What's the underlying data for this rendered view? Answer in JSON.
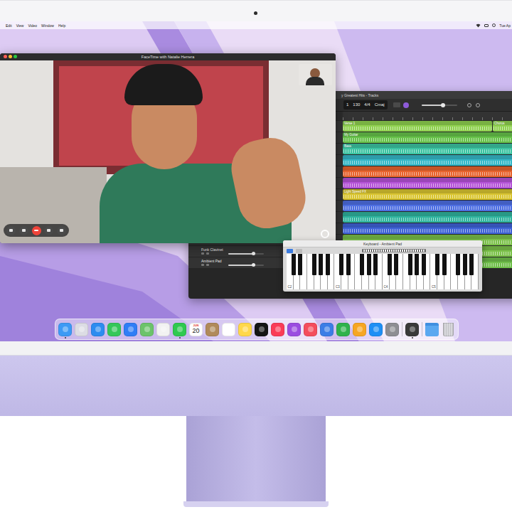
{
  "menubar": {
    "menus": [
      "Edit",
      "View",
      "Video",
      "Window",
      "Help"
    ],
    "clock": "Tue Ap"
  },
  "facetime": {
    "title": "FaceTime with Natalie Herrera",
    "controls": [
      {
        "kind": "sidebar"
      },
      {
        "kind": "mute"
      },
      {
        "kind": "end-call"
      },
      {
        "kind": "camera"
      },
      {
        "kind": "fullscreen"
      }
    ]
  },
  "garageband": {
    "title": "y Greatest Hits - Tracks",
    "lcd": {
      "bar": "1",
      "tempo": "130",
      "signature": "4/4",
      "key": "Cmaj"
    },
    "master_volume": {
      "level": 0.6
    },
    "tracks": [
      {
        "color": "#8fd14f",
        "labels": [
          "Verse 1",
          "Chorus"
        ]
      },
      {
        "color": "#67c24a",
        "labels": [
          "My Guitar"
        ]
      },
      {
        "color": "#3cc4a2",
        "labels": [
          "Bass"
        ]
      },
      {
        "color": "#35b8c8",
        "labels": []
      },
      {
        "color": "#e8642e",
        "labels": []
      },
      {
        "color": "#b553d8",
        "labels": []
      },
      {
        "color": "#d9c531",
        "labels": [
          "Light Speed FX"
        ]
      },
      {
        "color": "#4e6fe3",
        "labels": []
      },
      {
        "color": "#2fb49e",
        "labels": []
      },
      {
        "color": "#3f62d6",
        "labels": []
      },
      {
        "color": "#7cc24b",
        "labels": []
      },
      {
        "name": "Funk Clavinet",
        "level": 0.7,
        "color": "#7cc24b",
        "labels": []
      },
      {
        "name": "Ambient Pad",
        "level": 0.7,
        "color": "#6fbf4a",
        "labels": []
      }
    ]
  },
  "keyboard": {
    "title": "Keyboard - Ambient Pad",
    "labels": [
      "C2",
      "C3",
      "C4",
      "C5"
    ]
  },
  "dock": {
    "items": [
      {
        "kind": "app",
        "color": "#3d9af5",
        "running": true
      },
      {
        "kind": "app",
        "color": "#dcdce4",
        "running": false
      },
      {
        "kind": "app",
        "color": "#2d8cf0",
        "running": false
      },
      {
        "kind": "app",
        "color": "#34c759",
        "running": false
      },
      {
        "kind": "app",
        "color": "#2f7df6",
        "running": false
      },
      {
        "kind": "app",
        "color": "#6cc36b",
        "running": false
      },
      {
        "kind": "app",
        "color": "#f2f2f2",
        "running": false
      },
      {
        "kind": "app",
        "color": "#2fc94f",
        "running": true
      },
      {
        "kind": "calendar",
        "color": "#ffffff",
        "month": "JUN",
        "day": "20",
        "running": false
      },
      {
        "kind": "app",
        "color": "#b08a5a",
        "running": false
      },
      {
        "kind": "app",
        "color": "#ffffff",
        "running": false
      },
      {
        "kind": "app",
        "color": "#ffd84a",
        "running": false
      },
      {
        "kind": "app",
        "color": "#151515",
        "running": false
      },
      {
        "kind": "app",
        "color": "#fa3c57",
        "running": false
      },
      {
        "kind": "app",
        "color": "#9b4de0",
        "running": false
      },
      {
        "kind": "app",
        "color": "#f44d5c",
        "running": false
      },
      {
        "kind": "app",
        "color": "#3b7de6",
        "running": false
      },
      {
        "kind": "app",
        "color": "#2fb24c",
        "running": false
      },
      {
        "kind": "app",
        "color": "#f6a623",
        "running": false
      },
      {
        "kind": "app",
        "color": "#1e8ff5",
        "running": false
      },
      {
        "kind": "app",
        "color": "#8e8e93",
        "running": false
      },
      {
        "kind": "separator"
      },
      {
        "kind": "app",
        "color": "#3a3a3a",
        "running": true
      },
      {
        "kind": "separator"
      },
      {
        "kind": "folder",
        "color": "#5aa8f0",
        "running": false
      },
      {
        "kind": "trash",
        "color": "#d8d8dc",
        "running": false
      }
    ]
  }
}
